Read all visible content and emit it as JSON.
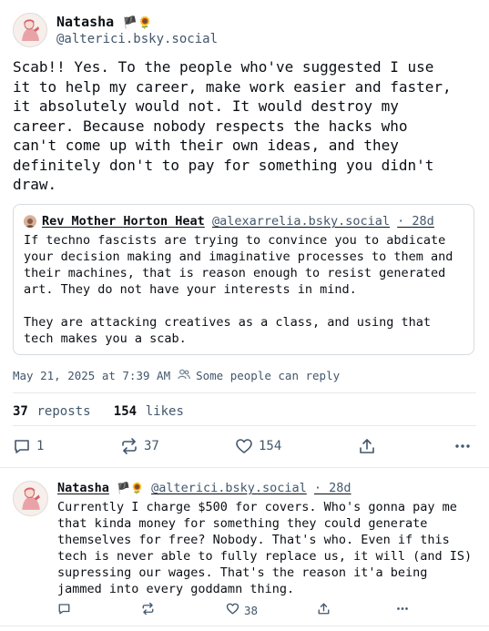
{
  "post": {
    "author_name": "Natasha",
    "author_emoji": "🏴🌻",
    "author_handle": "@alterici.bsky.social",
    "text": "Scab!! Yes. To the people who've suggested I use\nit to help my career, make work easier and faster,\nit absolutely would not. It would destroy my\ncareer. Because nobody respects the hacks who\ncan't come up with their own ideas, and they\ndefinitely don't to pay for something you didn't\ndraw.",
    "timestamp": "May 21, 2025 at 7:39 AM",
    "reply_setting": "Some people can reply"
  },
  "quote": {
    "author_name": "Rev Mother Horton Heat",
    "author_handle": "@alexarrelia.bsky.social",
    "age": "· 28d",
    "text": "If techno fascists are trying to convince you to abdicate\nyour decision making and imaginative processes to them and\ntheir machines, that is reason enough to resist generated\nart. They do not have your interests in mind.\n\nThey are attacking creatives as a class, and using that\ntech makes you a scab."
  },
  "stats": {
    "reposts_count": "37",
    "reposts_label": "reposts",
    "likes_count": "154",
    "likes_label": "likes"
  },
  "actions": {
    "reply_count": "1",
    "repost_count": "37",
    "like_count": "154"
  },
  "reply": {
    "author_name": "Natasha",
    "author_emoji": "🏴🌻",
    "author_handle": "@alterici.bsky.social",
    "age": "· 28d",
    "text": "Currently I charge $500 for covers. Who's gonna pay me\nthat kinda money for something they could generate\nthemselves for free? Nobody. That's who. Even if this\ntech is never able to fully replace us, it will (and IS)\nsupressing our wages. That's the reason it'a being\njammed into every goddamn thing.",
    "like_count": "38"
  }
}
